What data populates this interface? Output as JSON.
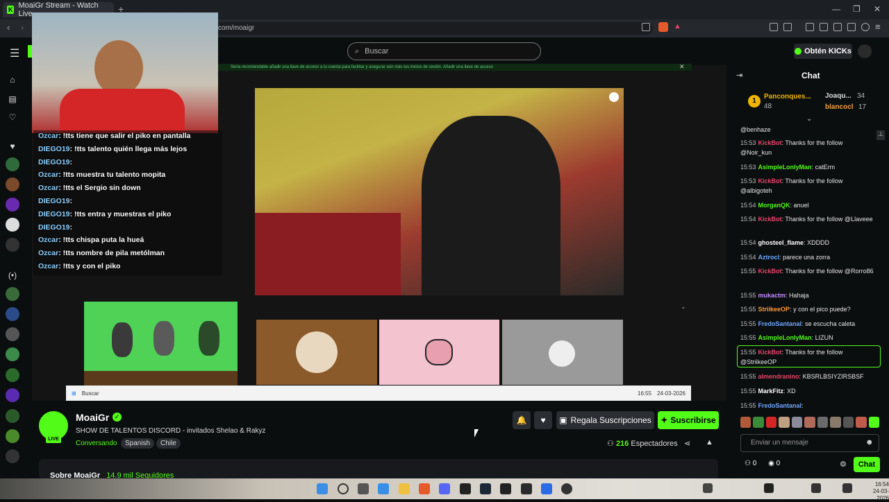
{
  "browser": {
    "tab_title": "MoaiGr Stream - Watch Live ...",
    "new_tab": "+",
    "url": "com/moaigr"
  },
  "header": {
    "search_placeholder": "Buscar",
    "get_kicks": "Obtén KICKs"
  },
  "banner": "Sería recomendable añadir una llave de acceso a tu cuenta para facilitar y asegurar aún más tus inicios de sesión.   Añadir una llave de acceso",
  "overlay_chat": [
    {
      "name": "Ozcar",
      "msg": "!tts tiene que salir el piko en pantalla"
    },
    {
      "name": "DIEGO19",
      "msg": "!tts talento quién llega más lejos"
    },
    {
      "name": "DIEGO19",
      "msg": ""
    },
    {
      "name": "Ozcar",
      "msg": "!tts muestra tu talento mopita"
    },
    {
      "name": "Ozcar",
      "msg": "!tts el Sergio sin down"
    },
    {
      "name": "DIEGO19",
      "msg": ""
    },
    {
      "name": "DIEGO19",
      "msg": "!tts entra y muestras el piko"
    },
    {
      "name": "DIEGO19",
      "msg": ""
    },
    {
      "name": "Ozcar",
      "msg": "!tts chispa puta la hueá"
    },
    {
      "name": "Ozcar",
      "msg": "!tts nombre de pila metólman"
    },
    {
      "name": "Ozcar",
      "msg": "!tts y con el piko"
    }
  ],
  "inner_taskbar": {
    "search": "Buscar",
    "time": "16:55",
    "date": "24-03-2026"
  },
  "channel": {
    "name": "MoaiGr",
    "live": "LIVE",
    "title": "SHOW DE TALENTOS DISCORD - invitados Shelao & Rakyz",
    "category": "Conversando",
    "tags": [
      "Spanish",
      "Chile"
    ],
    "gift_subs": "Regala Suscripciones",
    "subscribe": "Suscribirse",
    "viewers_count": "216",
    "viewers_label": "Espectadores",
    "about": "Sobre MoaiGr",
    "followers": "14.9 mil Seguidores"
  },
  "chat": {
    "title": "Chat",
    "top_gifters": [
      {
        "rank": "1",
        "name": "Panconques...",
        "count": "48"
      },
      {
        "name": "Joaqu...",
        "count": "34"
      },
      {
        "name": "blancocl",
        "count": "17"
      }
    ],
    "messages": [
      {
        "time": "",
        "user": "",
        "text": "@benhaze",
        "color": "#e6e6e6"
      },
      {
        "time": "15:53",
        "user": "KickBot",
        "text": "Thanks for the follow @Noir_kun",
        "color": "#e8446a"
      },
      {
        "time": "15:53",
        "user": "AsimpleLonlyMan",
        "text": "catErm",
        "color": "#53fc18"
      },
      {
        "time": "15:53",
        "user": "KickBot",
        "text": "Thanks for the follow @albigoteh",
        "color": "#e8446a"
      },
      {
        "time": "15:54",
        "user": "MorganQK",
        "text": "anuel",
        "color": "#53fc18"
      },
      {
        "time": "15:54",
        "user": "KickBot",
        "text": "Thanks for the follow @Llaveee",
        "color": "#e8446a"
      },
      {
        "time": "15:54",
        "user": "ghosteel_flame",
        "text": "XDDDD",
        "color": "#ffffff"
      },
      {
        "time": "15:54",
        "user": "Aztrocl",
        "text": "parece una zorra",
        "color": "#6fa8ff"
      },
      {
        "time": "15:55",
        "user": "KickBot",
        "text": "Thanks for the follow @Rorro86",
        "color": "#e8446a"
      },
      {
        "time": "15:55",
        "user": "mukactm",
        "text": "Hahaja",
        "color": "#c58cff"
      },
      {
        "time": "15:55",
        "user": "StriikeeOP",
        "text": "y con el pico puede?",
        "color": "#ff9a3c"
      },
      {
        "time": "15:55",
        "user": "FredoSantanal",
        "text": "se escucha caleta",
        "color": "#6fa8ff"
      },
      {
        "time": "15:55",
        "user": "AsimpleLonlyMan",
        "text": "LIZUN",
        "color": "#53fc18"
      },
      {
        "time": "15:55",
        "user": "KickBot",
        "text": "Thanks for the follow @StriikeeOP",
        "color": "#e8446a"
      },
      {
        "time": "15:55",
        "user": "almendranino",
        "text": "KBSRLBSIYZIRSBSF",
        "color": "#e8446a"
      },
      {
        "time": "15:55",
        "user": "MarkFitz",
        "text": "XD",
        "color": "#ffffff"
      },
      {
        "time": "15:55",
        "user": "FredoSantanal",
        "text": "",
        "color": "#6fa8ff"
      }
    ],
    "input_placeholder": "Enviar un mensaje",
    "points": "0",
    "kicks": "0",
    "send": "Chat"
  },
  "os_clock": {
    "time": "16:54",
    "date": "24-03-2026"
  }
}
